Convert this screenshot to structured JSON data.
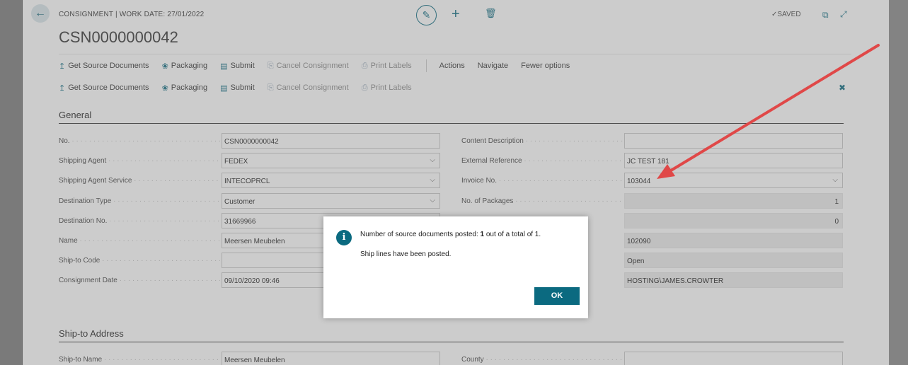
{
  "header": {
    "caption": "CONSIGNMENT | WORK DATE: 27/01/2022",
    "title": "CSN0000000042",
    "saved": "SAVED"
  },
  "actions_primary": [
    {
      "label": "Get Source Documents",
      "icon": "get-source-icon",
      "enabled": true
    },
    {
      "label": "Packaging",
      "icon": "packaging-icon",
      "enabled": true
    },
    {
      "label": "Submit",
      "icon": "submit-icon",
      "enabled": true
    },
    {
      "label": "Cancel Consignment",
      "icon": "cancel-icon",
      "enabled": false
    },
    {
      "label": "Print Labels",
      "icon": "print-icon",
      "enabled": false
    }
  ],
  "actions_menu": [
    "Actions",
    "Navigate",
    "Fewer options"
  ],
  "actions_secondary": [
    {
      "label": "Get Source Documents",
      "icon": "get-source-icon",
      "enabled": true
    },
    {
      "label": "Packaging",
      "icon": "packaging-icon",
      "enabled": true
    },
    {
      "label": "Submit",
      "icon": "submit-icon",
      "enabled": true
    },
    {
      "label": "Cancel Consignment",
      "icon": "cancel-icon",
      "enabled": false
    },
    {
      "label": "Print Labels",
      "icon": "print-icon",
      "enabled": false
    }
  ],
  "general": {
    "title": "General",
    "left": [
      {
        "label": "No.",
        "value": "CSN0000000042",
        "readonly": false,
        "dropdown": false
      },
      {
        "label": "Shipping Agent",
        "value": "FEDEX",
        "readonly": false,
        "dropdown": true
      },
      {
        "label": "Shipping Agent Service",
        "value": "INTECOPRCL",
        "readonly": false,
        "dropdown": true
      },
      {
        "label": "Destination Type",
        "value": "Customer",
        "readonly": false,
        "dropdown": true
      },
      {
        "label": "Destination No.",
        "value": "31669966",
        "readonly": false,
        "dropdown": false
      },
      {
        "label": "Name",
        "value": "Meersen Meubelen",
        "readonly": false,
        "dropdown": false
      },
      {
        "label": "Ship-to Code",
        "value": "",
        "readonly": false,
        "dropdown": false
      },
      {
        "label": "Consignment Date",
        "value": "09/10/2020 09:46",
        "readonly": false,
        "dropdown": false
      }
    ],
    "right": [
      {
        "label": "Content Description",
        "value": "",
        "readonly": false,
        "dropdown": false,
        "numeric": false
      },
      {
        "label": "External Reference",
        "value": "JC TEST 181",
        "readonly": false,
        "dropdown": false,
        "numeric": false
      },
      {
        "label": "Invoice No.",
        "value": "103044",
        "readonly": false,
        "dropdown": true,
        "numeric": false
      },
      {
        "label": "No. of Packages",
        "value": "1",
        "readonly": true,
        "dropdown": false,
        "numeric": true
      },
      {
        "label": "",
        "value": "0",
        "readonly": true,
        "dropdown": false,
        "numeric": true
      },
      {
        "label": "",
        "value": "102090",
        "readonly": true,
        "dropdown": false,
        "numeric": false
      },
      {
        "label": "",
        "value": "Open",
        "readonly": true,
        "dropdown": false,
        "numeric": false
      },
      {
        "label": "",
        "value": "HOSTING\\JAMES.CROWTER",
        "readonly": true,
        "dropdown": false,
        "numeric": false
      }
    ]
  },
  "ship_to": {
    "title": "Ship-to Address",
    "left": [
      {
        "label": "Ship-to Name",
        "value": "Meersen Meubelen"
      }
    ],
    "right": [
      {
        "label": "County",
        "value": ""
      }
    ]
  },
  "dialog": {
    "message_prefix": "Number of source documents posted: ",
    "posted_count": "1",
    "message_suffix": " out of a total of 1.",
    "message2": "Ship lines have been posted.",
    "ok_label": "OK"
  },
  "colors": {
    "accent": "#0b6a80",
    "arrow": "#e04848"
  }
}
